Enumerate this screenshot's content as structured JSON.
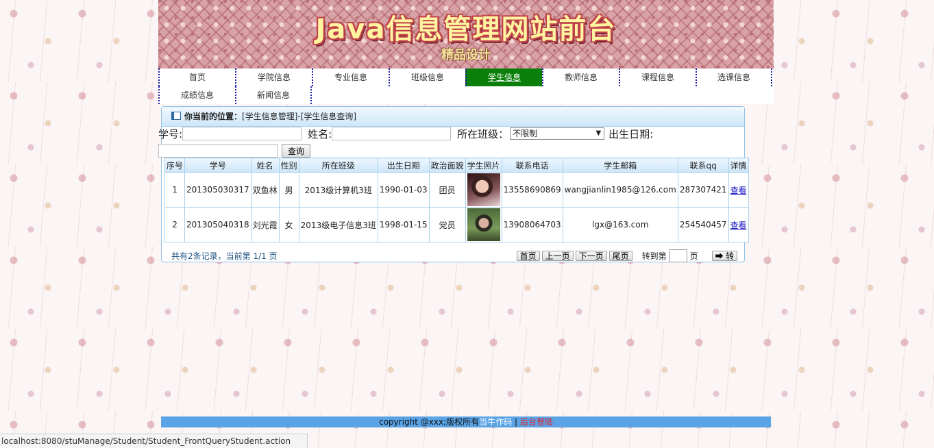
{
  "banner": {
    "title": "Java信息管理网站前台",
    "subtitle": "精品设计"
  },
  "nav": {
    "row1": [
      {
        "label": "首页"
      },
      {
        "label": "学院信息"
      },
      {
        "label": "专业信息"
      },
      {
        "label": "班级信息"
      },
      {
        "label": "学生信息",
        "active": true
      },
      {
        "label": "教师信息"
      },
      {
        "label": "课程信息"
      },
      {
        "label": "选课信息"
      }
    ],
    "row2": [
      {
        "label": "成绩信息"
      },
      {
        "label": "新闻信息"
      }
    ]
  },
  "breadcrumb": {
    "prefix": "你当前的位置：",
    "path": "[学生信息管理]-[学生信息查询]"
  },
  "search": {
    "student_no_label": "学号:",
    "student_no_value": "",
    "name_label": "姓名:",
    "name_value": "",
    "class_label": "所在班级：",
    "class_selected": "不限制",
    "birth_label": "出生日期:",
    "birth_value": "",
    "query_button": "查询"
  },
  "table": {
    "headers": [
      "序号",
      "学号",
      "姓名",
      "性别",
      "所在班级",
      "出生日期",
      "政治面貌",
      "学生照片",
      "联系电话",
      "学生邮箱",
      "联系qq",
      "详情"
    ],
    "rows": [
      {
        "index": "1",
        "student_no": "201305030317",
        "name": "双鱼林",
        "gender": "男",
        "class": "2013级计算机3班",
        "birth": "1990-01-03",
        "politics": "团员",
        "phone": "13558690869",
        "email": "wangjianlin1985@126.com",
        "qq": "287307421",
        "detail": "查看"
      },
      {
        "index": "2",
        "student_no": "201305040318",
        "name": "刘光霞",
        "gender": "女",
        "class": "2013级电子信息3班",
        "birth": "1998-01-15",
        "politics": "党员",
        "phone": "13908064703",
        "email": "lgx@163.com",
        "qq": "254540457",
        "detail": "查看"
      }
    ]
  },
  "pager": {
    "info": "共有2条记录，当前第 1/1 页",
    "first": "首页",
    "prev": "上一页",
    "next": "下一页",
    "last": "尾页",
    "goto_label": "转到第",
    "page_unit": "页",
    "go_button": "➡ 转"
  },
  "footer": {
    "copyright": "copyright @xxx;版权所有",
    "author": "当牛作码",
    "separator": "|",
    "admin_login": "后台登陆"
  },
  "statusbar": {
    "url": "localhost:8080/stuManage/Student/Student_FrontQueryStudent.action"
  },
  "colors": {
    "nav_active": "#0a7f0a",
    "footer_bg": "#5aa4e6",
    "footer_login": "#e0202a"
  }
}
